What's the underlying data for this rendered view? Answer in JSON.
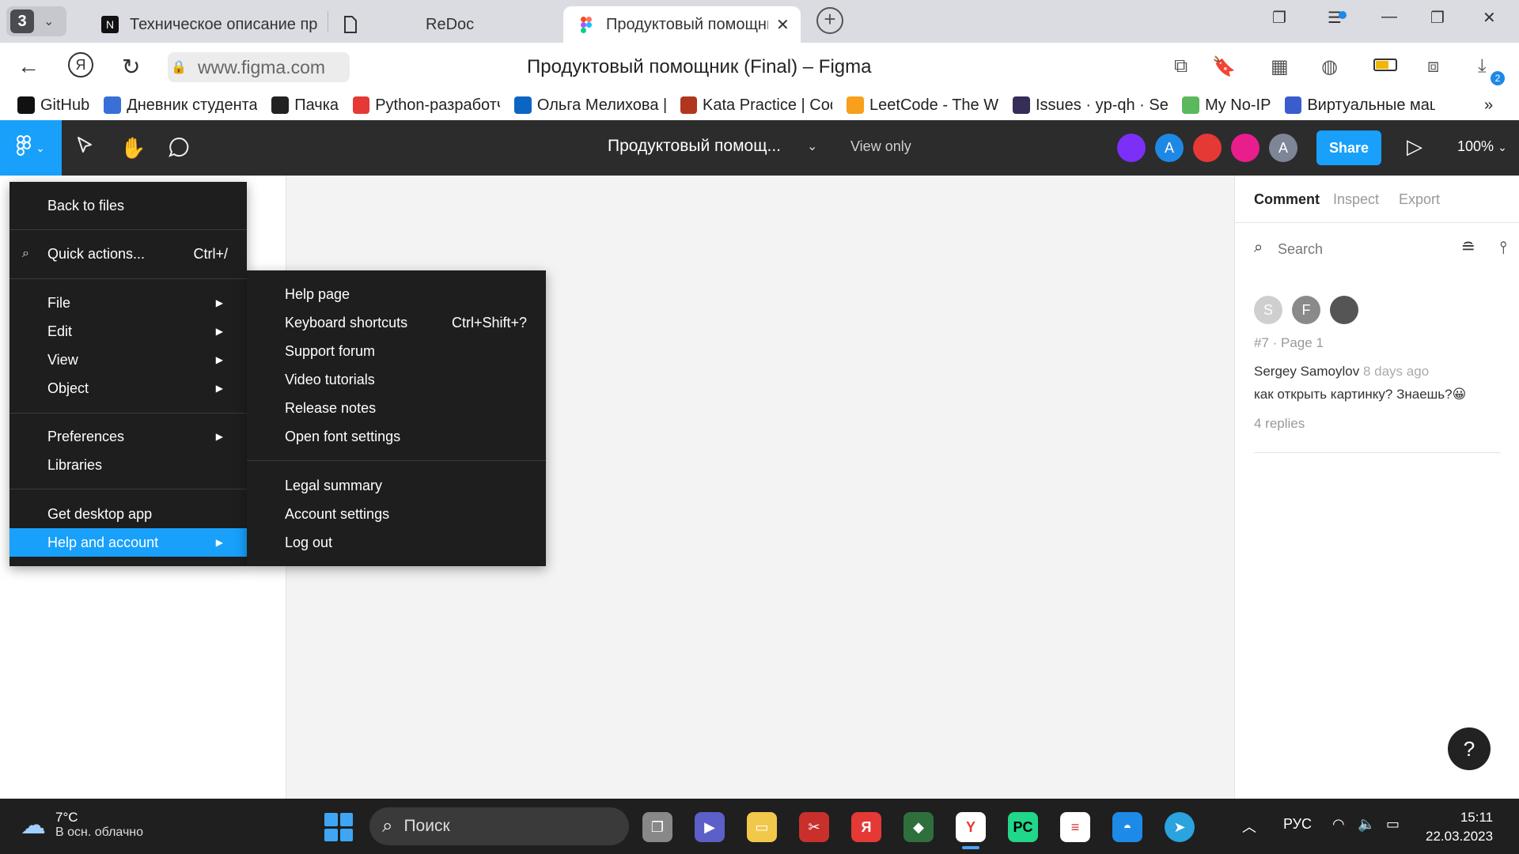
{
  "browser": {
    "tab_count": "3",
    "tabs": [
      {
        "title": "Техническое описание пр",
        "icon": "notion-icon"
      },
      {
        "title": "ReDoc",
        "icon": "document-icon"
      },
      {
        "title": "Продуктовый помощни",
        "icon": "figma-icon",
        "active": true
      }
    ],
    "url": "www.figma.com",
    "page_title": "Продуктовый помощник (Final) – Figma",
    "downloads_badge": "2",
    "bookmarks": [
      {
        "label": "GitHub",
        "icon": "github-icon",
        "color": "#111111"
      },
      {
        "label": "Дневник студента",
        "icon": "book-icon",
        "color": "#3a6fd8"
      },
      {
        "label": "Пачка",
        "icon": "stack-icon",
        "color": "#222222"
      },
      {
        "label": "Python-разработч",
        "icon": "yandex-icon",
        "color": "#e53935"
      },
      {
        "label": "Ольга Мелихова |",
        "icon": "linkedin-icon",
        "color": "#0a66c2"
      },
      {
        "label": "Kata Practice | Cod",
        "icon": "codewars-icon",
        "color": "#b1361e"
      },
      {
        "label": "LeetCode - The W",
        "icon": "leetcode-icon",
        "color": "#f89f1b"
      },
      {
        "label": "Issues · yp-qh · Se",
        "icon": "sentry-icon",
        "color": "#362d59"
      },
      {
        "label": "My No-IP",
        "icon": "noip-icon",
        "color": "#5cb85c"
      },
      {
        "label": "Виртуальные маш",
        "icon": "yandex-cloud-icon",
        "color": "#3a5ccc"
      }
    ]
  },
  "figma": {
    "file_name": "Продуктовый помощ...",
    "view_mode": "View only",
    "avatars": [
      {
        "initial": "",
        "color": "#7b2ff7"
      },
      {
        "initial": "A",
        "color": "#1e88e5"
      },
      {
        "initial": "",
        "color": "#e53935"
      },
      {
        "initial": "",
        "color": "#e91e8c"
      },
      {
        "initial": "A",
        "color": "#7d8596"
      }
    ],
    "share_label": "Share",
    "zoom_label": "100%",
    "main_menu": {
      "back": "Back to files",
      "quick_actions": "Quick actions...",
      "quick_actions_shortcut": "Ctrl+/",
      "file": "File",
      "edit": "Edit",
      "view": "View",
      "object": "Object",
      "preferences": "Preferences",
      "libraries": "Libraries",
      "desktop_app": "Get desktop app",
      "help_account": "Help and account"
    },
    "help_submenu": {
      "help_page": "Help page",
      "keyboard_shortcuts": "Keyboard shortcuts",
      "keyboard_shortcuts_sc": "Ctrl+Shift+?",
      "support_forum": "Support forum",
      "video_tutorials": "Video tutorials",
      "release_notes": "Release notes",
      "font_settings": "Open font settings",
      "legal_summary": "Legal summary",
      "account_settings": "Account settings",
      "log_out": "Log out"
    },
    "right_panel": {
      "tabs": [
        "Comment",
        "Inspect",
        "Export"
      ],
      "search_placeholder": "Search",
      "comment": {
        "avatars": [
          {
            "initial": "S",
            "color": "#cfcfcf"
          },
          {
            "initial": "F",
            "color": "#8a8a8a"
          },
          {
            "initial": "",
            "color": "#555555"
          }
        ],
        "meta": "#7 · Page 1",
        "author": "Sergey Samoylov",
        "time": "8 days ago",
        "text": "как открыть картинку? Знаешь?😀",
        "replies": "4 replies"
      }
    }
  },
  "taskbar": {
    "temperature": "7°C",
    "weather": "В осн. облачно",
    "search_placeholder": "Поиск",
    "language": "РУС",
    "time": "15:11",
    "date": "22.03.2023"
  }
}
